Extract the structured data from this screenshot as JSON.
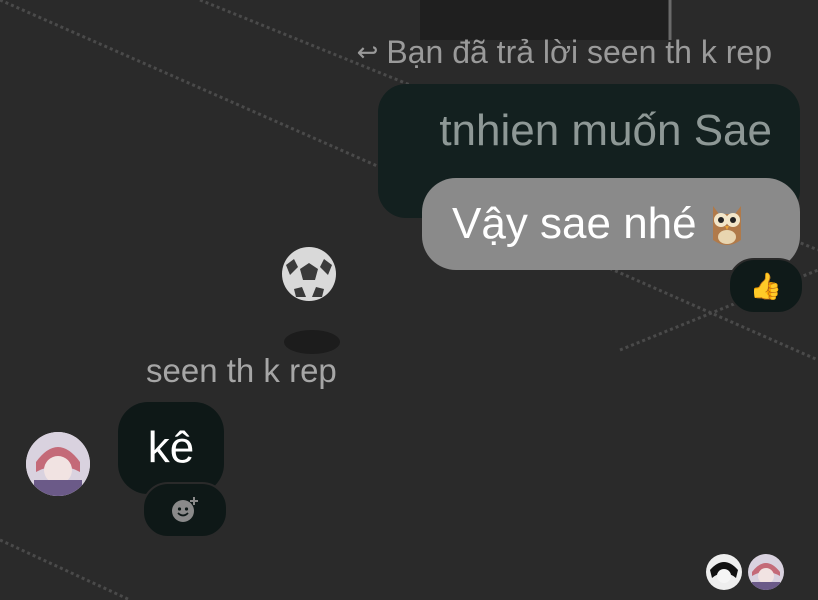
{
  "chat": {
    "reply_note": "Bạn đã trả lời seen th k rep",
    "quoted_message": "tnhien muốn Sae",
    "sent_message": "Vậy sae nhé",
    "sent_reaction_icon": "thumbs-up-icon",
    "received_sender_label": "seen th k rep",
    "received_message": "kê",
    "add_reaction_icon": "add-reaction-icon",
    "seen_by_icons": [
      "seen-avatar-1",
      "seen-avatar-2"
    ]
  },
  "colors": {
    "background": "#2a2a2a",
    "sent_bubble": "#8a8a8a",
    "quoted_bubble": "#13201f",
    "received_bubble": "#0e1817"
  }
}
